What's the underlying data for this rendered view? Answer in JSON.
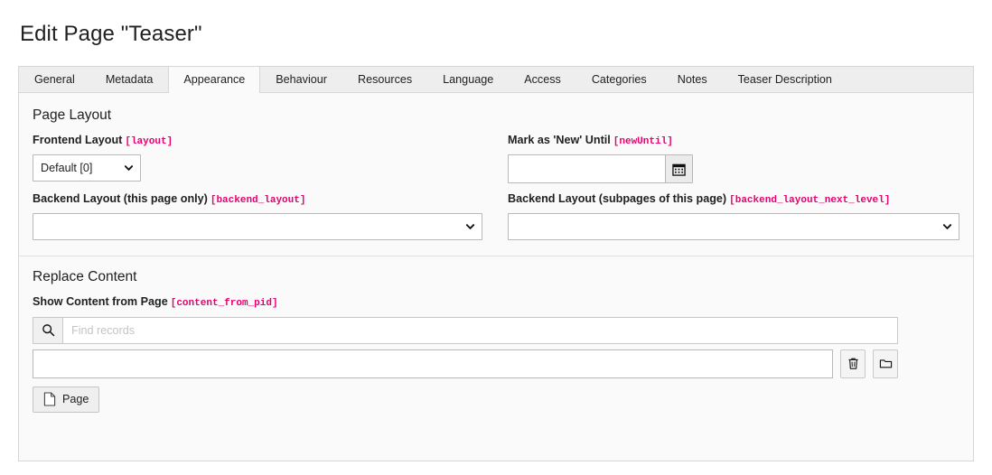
{
  "header": {
    "title": "Edit Page \"Teaser\""
  },
  "tabs": [
    {
      "label": "General",
      "active": false
    },
    {
      "label": "Metadata",
      "active": false
    },
    {
      "label": "Appearance",
      "active": true
    },
    {
      "label": "Behaviour",
      "active": false
    },
    {
      "label": "Resources",
      "active": false
    },
    {
      "label": "Language",
      "active": false
    },
    {
      "label": "Access",
      "active": false
    },
    {
      "label": "Categories",
      "active": false
    },
    {
      "label": "Notes",
      "active": false
    },
    {
      "label": "Teaser Description",
      "active": false
    }
  ],
  "sections": {
    "page_layout": {
      "title": "Page Layout",
      "frontend_layout": {
        "label": "Frontend Layout",
        "key": "[layout]",
        "value": "Default [0]",
        "options": [
          "Default [0]"
        ]
      },
      "mark_as_new_until": {
        "label": "Mark as 'New' Until",
        "key": "[newUntil]",
        "value": "",
        "placeholder": "",
        "calendar_icon": "calendar-icon"
      },
      "backend_layout": {
        "label": "Backend Layout (this page only)",
        "key": "[backend_layout]",
        "value": "",
        "options": [
          ""
        ]
      },
      "backend_layout_next_level": {
        "label": "Backend Layout (subpages of this page)",
        "key": "[backend_layout_next_level]",
        "value": "",
        "options": [
          ""
        ]
      }
    },
    "replace_content": {
      "title": "Replace Content",
      "show_content_from_page": {
        "label": "Show Content from Page",
        "key": "[content_from_pid]",
        "search_value": "",
        "search_placeholder": "Find records",
        "search_icon": "search-icon",
        "selected_records": [],
        "actions": [
          {
            "name": "delete-record-button",
            "icon": "trash-icon"
          },
          {
            "name": "browse-records-button",
            "icon": "folder-icon"
          }
        ],
        "browse_button": {
          "label": "Page",
          "icon": "page-icon"
        }
      }
    }
  },
  "colors": {
    "accent_key": "#e8006f",
    "panel_bg": "#fafafa",
    "tabbar_bg": "#eeeeee",
    "border": "#d7d7d7"
  }
}
